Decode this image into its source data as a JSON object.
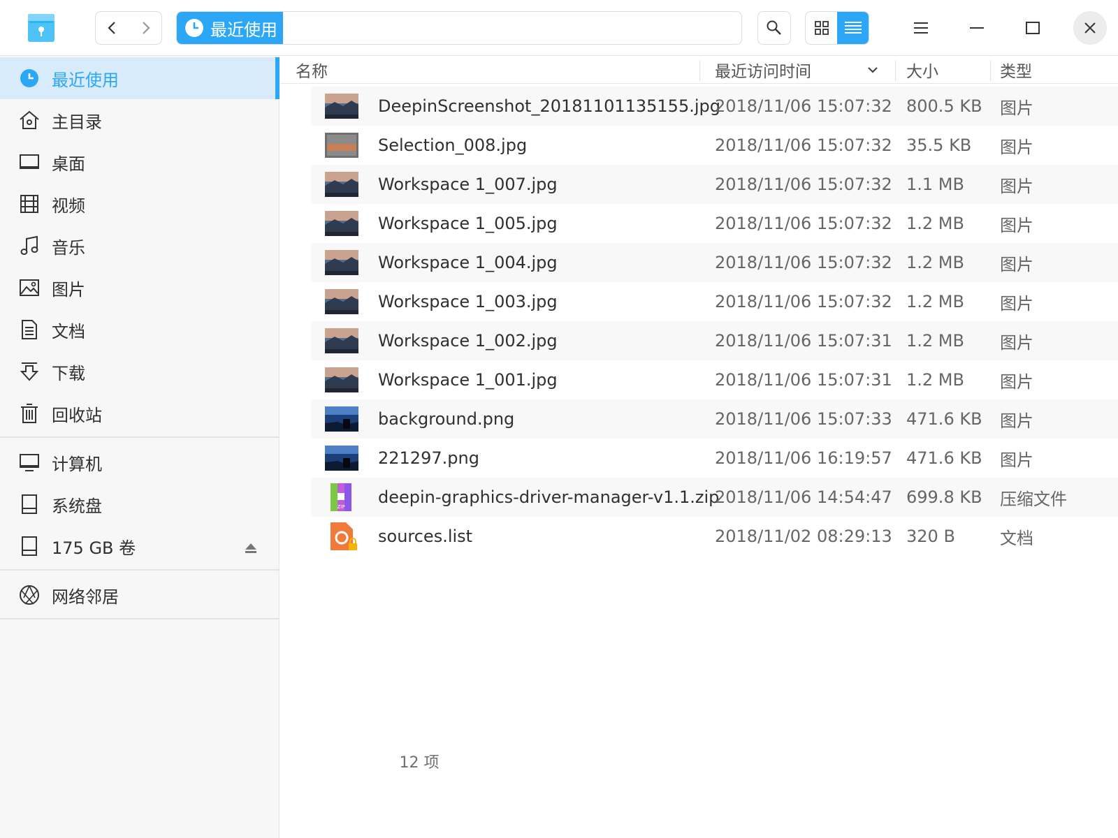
{
  "titlebar": {
    "breadcrumb": "最近使用"
  },
  "sidebar": {
    "items": [
      {
        "label": "最近使用",
        "icon": "clock-icon"
      },
      {
        "label": "主目录",
        "icon": "home-icon"
      },
      {
        "label": "桌面",
        "icon": "desktop-icon"
      },
      {
        "label": "视频",
        "icon": "video-icon"
      },
      {
        "label": "音乐",
        "icon": "music-icon"
      },
      {
        "label": "图片",
        "icon": "picture-icon"
      },
      {
        "label": "文档",
        "icon": "document-icon"
      },
      {
        "label": "下载",
        "icon": "download-icon"
      },
      {
        "label": "回收站",
        "icon": "trash-icon"
      }
    ],
    "devices": [
      {
        "label": "计算机",
        "icon": "computer-icon"
      },
      {
        "label": "系统盘",
        "icon": "disk-icon"
      },
      {
        "label": "175 GB 卷",
        "icon": "disk-icon"
      }
    ],
    "network": {
      "label": "网络邻居",
      "icon": "network-icon"
    }
  },
  "list": {
    "headers": {
      "name": "名称",
      "time": "最近访问时间",
      "size": "大小",
      "type": "类型"
    },
    "files": [
      {
        "name": "DeepinScreenshot_20181101135155.jpg",
        "time": "2018/11/06 15:07:32",
        "size": "800.5 KB",
        "type": "图片",
        "thumb": "landscape"
      },
      {
        "name": "Selection_008.jpg",
        "time": "2018/11/06 15:07:32",
        "size": "35.5 KB",
        "type": "图片",
        "thumb": "screenshot"
      },
      {
        "name": "Workspace 1_007.jpg",
        "time": "2018/11/06 15:07:32",
        "size": "1.1 MB",
        "type": "图片",
        "thumb": "landscape"
      },
      {
        "name": "Workspace 1_005.jpg",
        "time": "2018/11/06 15:07:32",
        "size": "1.2 MB",
        "type": "图片",
        "thumb": "landscape"
      },
      {
        "name": "Workspace 1_004.jpg",
        "time": "2018/11/06 15:07:32",
        "size": "1.2 MB",
        "type": "图片",
        "thumb": "landscape"
      },
      {
        "name": "Workspace 1_003.jpg",
        "time": "2018/11/06 15:07:32",
        "size": "1.2 MB",
        "type": "图片",
        "thumb": "landscape"
      },
      {
        "name": "Workspace 1_002.jpg",
        "time": "2018/11/06 15:07:31",
        "size": "1.2 MB",
        "type": "图片",
        "thumb": "landscape"
      },
      {
        "name": "Workspace 1_001.jpg",
        "time": "2018/11/06 15:07:31",
        "size": "1.2 MB",
        "type": "图片",
        "thumb": "landscape"
      },
      {
        "name": "background.png",
        "time": "2018/11/06 15:07:33",
        "size": "471.6 KB",
        "type": "图片",
        "thumb": "night"
      },
      {
        "name": "221297.png",
        "time": "2018/11/06 16:19:57",
        "size": "471.6 KB",
        "type": "图片",
        "thumb": "night"
      },
      {
        "name": "deepin-graphics-driver-manager-v1.1.zip",
        "time": "2018/11/06 14:54:47",
        "size": "699.8 KB",
        "type": "压缩文件",
        "thumb": "zip"
      },
      {
        "name": "sources.list",
        "time": "2018/11/02 08:29:13",
        "size": "320 B",
        "type": "文档",
        "thumb": "text-locked"
      }
    ]
  },
  "status": {
    "count": "12 项"
  },
  "colors": {
    "accent": "#2ca7f8",
    "active_bg": "#d7ebfa"
  }
}
